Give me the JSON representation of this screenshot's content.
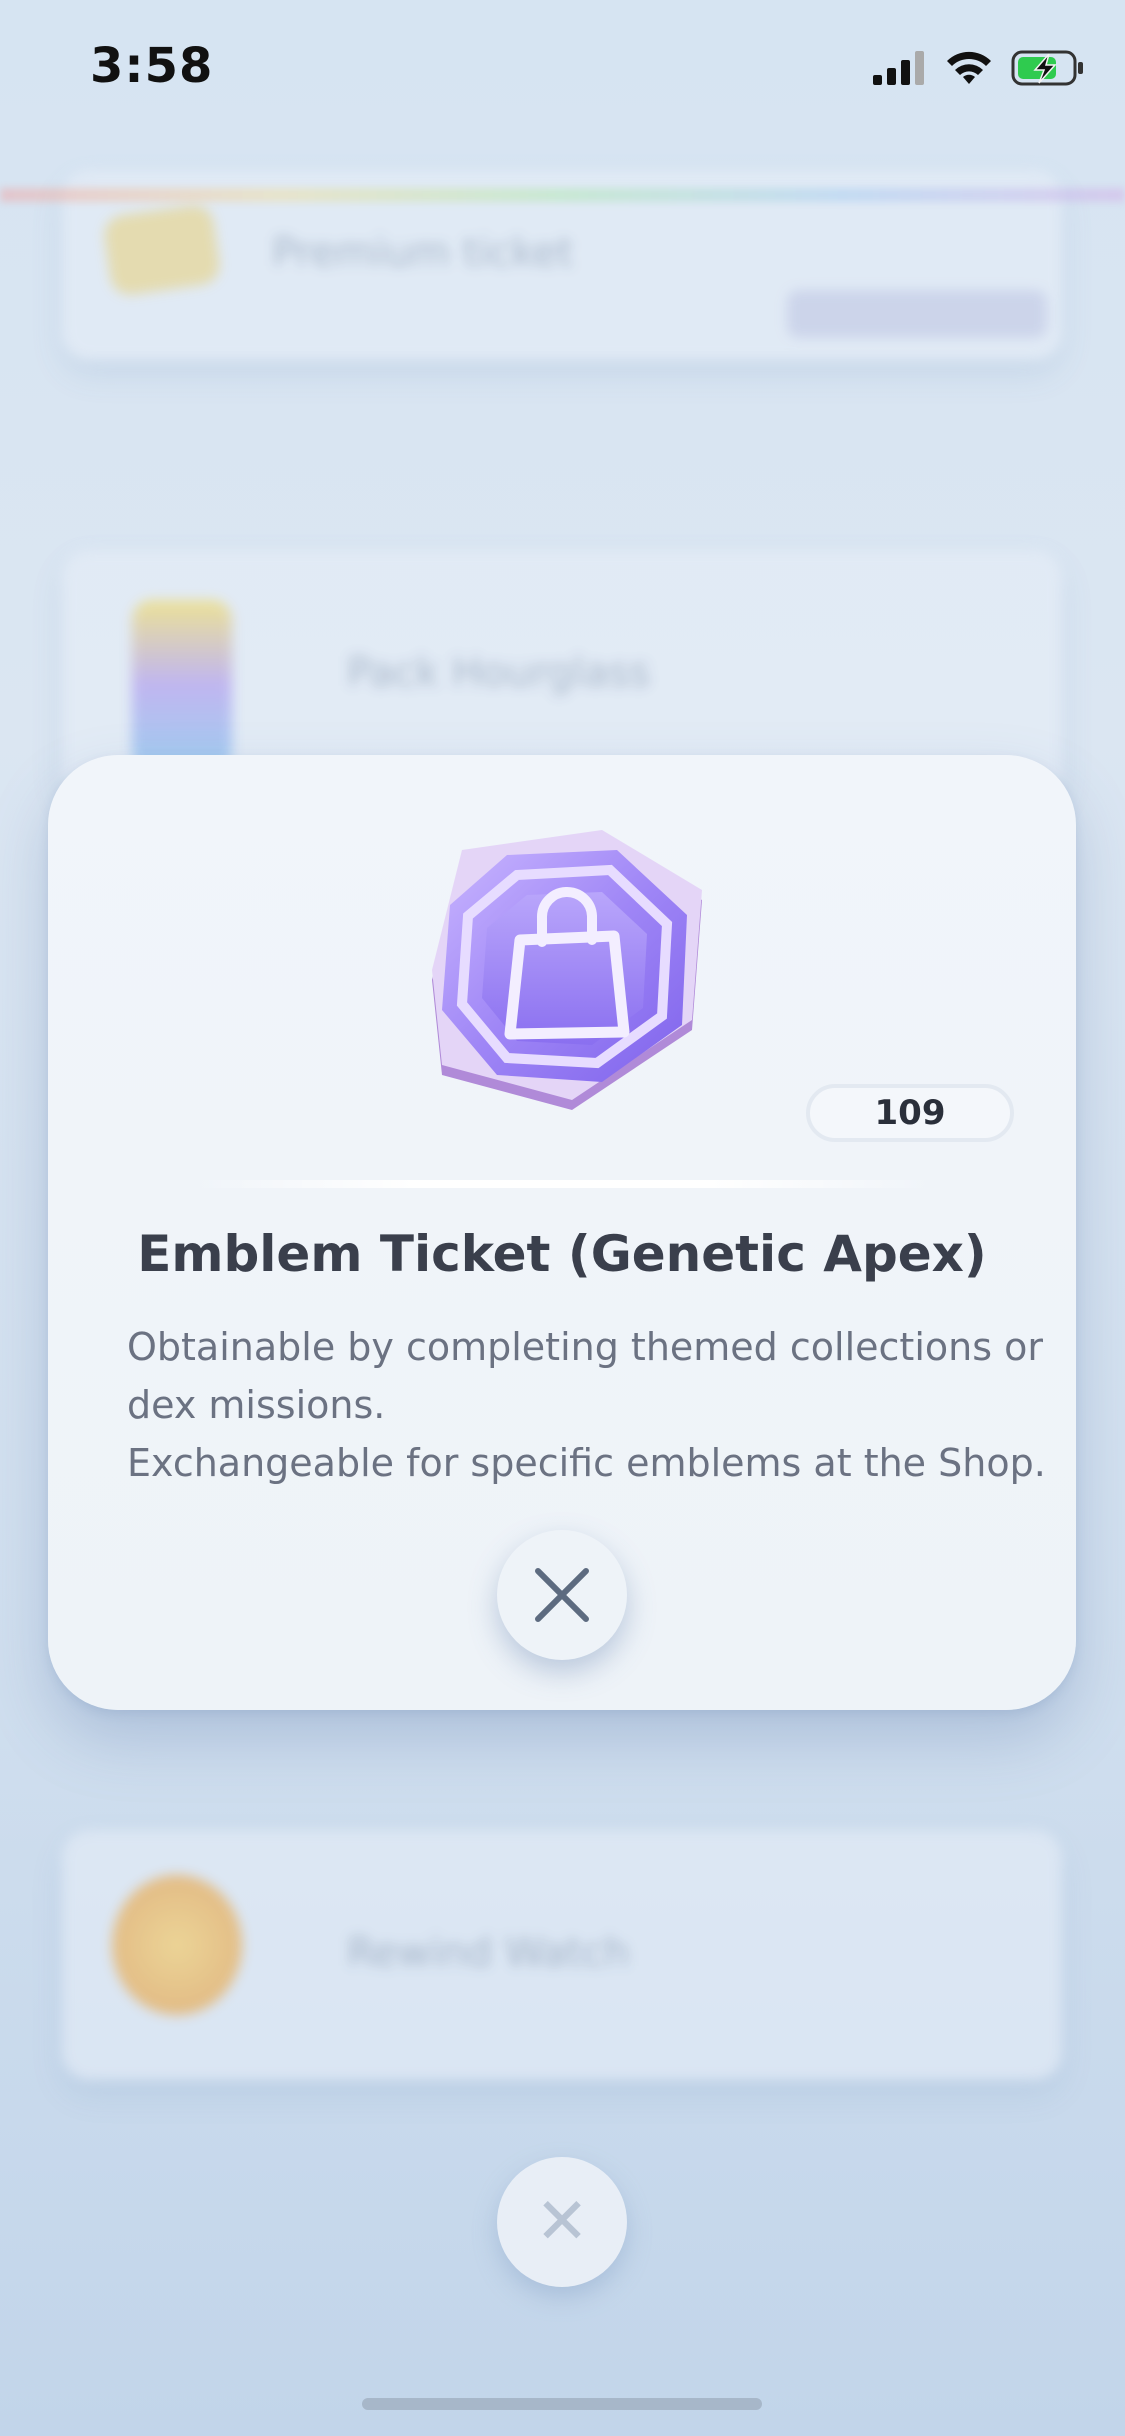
{
  "status_bar": {
    "time": "3:58",
    "icons": [
      "cellular-signal-icon",
      "wifi-icon",
      "battery-charging-icon"
    ]
  },
  "background": {
    "items": [
      {
        "label": "Premium ticket"
      },
      {
        "label": "Pack Hourglass"
      },
      {
        "label": "Rewind Watch"
      }
    ]
  },
  "modal": {
    "item_icon": "emblem-ticket-shopping-bag-icon",
    "count": "109",
    "title": "Emblem Ticket (Genetic Apex)",
    "description_lines": [
      "Obtainable by completing themed collections or",
      "dex missions.",
      "Exchangeable for specific emblems at the Shop."
    ],
    "close_icon": "close-icon"
  },
  "colors": {
    "emblem_purple": "#8b6ff0",
    "title_text": "#3a3f4c",
    "body_text": "#6b7282"
  }
}
